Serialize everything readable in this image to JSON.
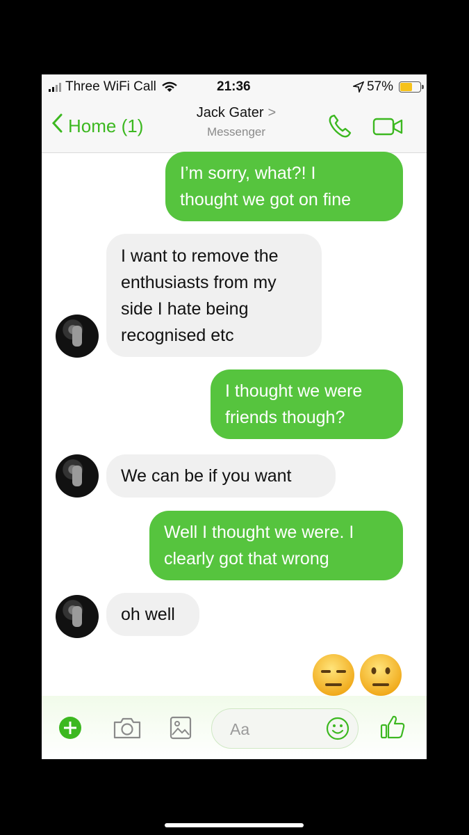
{
  "status_bar": {
    "carrier": "Three WiFi Call",
    "time": "21:36",
    "battery": "57%",
    "battery_level": 0.57
  },
  "nav": {
    "back_label": "Home (1)",
    "contact_name": "Jack Gater",
    "subtitle": "Messenger",
    "icons": [
      "chevron-left-icon",
      "phone-icon",
      "video-icon"
    ]
  },
  "messages": [
    {
      "dir": "out",
      "text": "I'm sorry, what?! I thought we got on fine",
      "lines": [
        "I’m sorry, what?! I",
        "thought we got on fine"
      ]
    },
    {
      "dir": "in",
      "text": "I want to remove the enthusiasts from my side I hate being recognised etc",
      "lines": [
        "I want to remove the",
        "enthusiasts from my",
        "side I hate being",
        "recognised etc"
      ]
    },
    {
      "dir": "out",
      "text": "I thought we were friends though?",
      "lines": [
        "I thought we were",
        "friends though?"
      ]
    },
    {
      "dir": "in",
      "text": "We can be if you want",
      "lines": [
        "We can be if you want"
      ]
    },
    {
      "dir": "out",
      "text": "Well I thought we were. I clearly got that wrong",
      "lines": [
        "Well I thought we were. I",
        "clearly got that wrong"
      ]
    },
    {
      "dir": "in",
      "text": "oh well",
      "lines": [
        "oh well"
      ]
    }
  ],
  "reactions": [
    "expressionless-face-emoji",
    "neutral-face-emoji"
  ],
  "composer": {
    "placeholder": "Aa",
    "icons": [
      "plus-icon",
      "camera-icon",
      "image-icon",
      "smiley-icon",
      "thumbs-up-icon"
    ]
  },
  "colors": {
    "accent": "#3cb820",
    "outgoing_bubble": "#56c43e",
    "incoming_bubble": "#f0f0f0"
  }
}
